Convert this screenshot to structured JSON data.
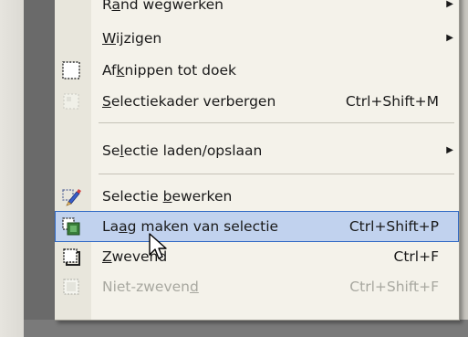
{
  "menu": {
    "items": [
      {
        "pre": "R",
        "u": "a",
        "post": "nd wegwerken",
        "shortcut": "",
        "submenu": true,
        "disabled": false,
        "icon": ""
      },
      {
        "pre": "",
        "u": "W",
        "post": "ijzigen",
        "shortcut": "",
        "submenu": true,
        "disabled": false,
        "icon": ""
      },
      {
        "pre": "Af",
        "u": "k",
        "post": "nippen tot doek",
        "shortcut": "",
        "submenu": false,
        "disabled": false,
        "icon": "crop-to-canvas-icon"
      },
      {
        "pre": "",
        "u": "S",
        "post": "electiekader verbergen",
        "shortcut": "Ctrl+Shift+M",
        "submenu": false,
        "disabled": false,
        "icon": "hide-marquee-icon"
      },
      {
        "pre": "Se",
        "u": "l",
        "post": "ectie laden/opslaan",
        "shortcut": "",
        "submenu": true,
        "disabled": false,
        "icon": ""
      },
      {
        "pre": "Selectie ",
        "u": "b",
        "post": "ewerken",
        "shortcut": "",
        "submenu": false,
        "disabled": false,
        "icon": "edit-selection-icon"
      },
      {
        "pre": "La",
        "u": "a",
        "post": "g maken van selectie",
        "shortcut": "Ctrl+Shift+P",
        "submenu": false,
        "disabled": false,
        "icon": "layer-from-selection-icon"
      },
      {
        "pre": "",
        "u": "Z",
        "post": "wevend",
        "shortcut": "Ctrl+F",
        "submenu": false,
        "disabled": false,
        "icon": "float-icon"
      },
      {
        "pre": "Niet-zweven",
        "u": "d",
        "post": "",
        "shortcut": "Ctrl+Shift+F",
        "submenu": false,
        "disabled": true,
        "icon": "defloat-icon"
      }
    ]
  }
}
